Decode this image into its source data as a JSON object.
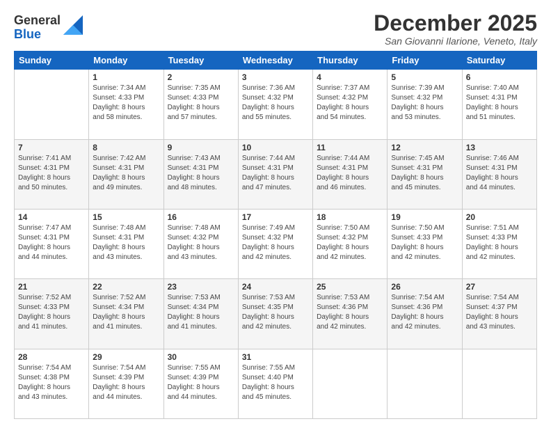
{
  "logo": {
    "general": "General",
    "blue": "Blue"
  },
  "title": "December 2025",
  "location": "San Giovanni Ilarione, Veneto, Italy",
  "days_of_week": [
    "Sunday",
    "Monday",
    "Tuesday",
    "Wednesday",
    "Thursday",
    "Friday",
    "Saturday"
  ],
  "weeks": [
    [
      {
        "day": "",
        "info": ""
      },
      {
        "day": "1",
        "info": "Sunrise: 7:34 AM\nSunset: 4:33 PM\nDaylight: 8 hours\nand 58 minutes."
      },
      {
        "day": "2",
        "info": "Sunrise: 7:35 AM\nSunset: 4:33 PM\nDaylight: 8 hours\nand 57 minutes."
      },
      {
        "day": "3",
        "info": "Sunrise: 7:36 AM\nSunset: 4:32 PM\nDaylight: 8 hours\nand 55 minutes."
      },
      {
        "day": "4",
        "info": "Sunrise: 7:37 AM\nSunset: 4:32 PM\nDaylight: 8 hours\nand 54 minutes."
      },
      {
        "day": "5",
        "info": "Sunrise: 7:39 AM\nSunset: 4:32 PM\nDaylight: 8 hours\nand 53 minutes."
      },
      {
        "day": "6",
        "info": "Sunrise: 7:40 AM\nSunset: 4:31 PM\nDaylight: 8 hours\nand 51 minutes."
      }
    ],
    [
      {
        "day": "7",
        "info": "Sunrise: 7:41 AM\nSunset: 4:31 PM\nDaylight: 8 hours\nand 50 minutes."
      },
      {
        "day": "8",
        "info": "Sunrise: 7:42 AM\nSunset: 4:31 PM\nDaylight: 8 hours\nand 49 minutes."
      },
      {
        "day": "9",
        "info": "Sunrise: 7:43 AM\nSunset: 4:31 PM\nDaylight: 8 hours\nand 48 minutes."
      },
      {
        "day": "10",
        "info": "Sunrise: 7:44 AM\nSunset: 4:31 PM\nDaylight: 8 hours\nand 47 minutes."
      },
      {
        "day": "11",
        "info": "Sunrise: 7:44 AM\nSunset: 4:31 PM\nDaylight: 8 hours\nand 46 minutes."
      },
      {
        "day": "12",
        "info": "Sunrise: 7:45 AM\nSunset: 4:31 PM\nDaylight: 8 hours\nand 45 minutes."
      },
      {
        "day": "13",
        "info": "Sunrise: 7:46 AM\nSunset: 4:31 PM\nDaylight: 8 hours\nand 44 minutes."
      }
    ],
    [
      {
        "day": "14",
        "info": "Sunrise: 7:47 AM\nSunset: 4:31 PM\nDaylight: 8 hours\nand 44 minutes."
      },
      {
        "day": "15",
        "info": "Sunrise: 7:48 AM\nSunset: 4:31 PM\nDaylight: 8 hours\nand 43 minutes."
      },
      {
        "day": "16",
        "info": "Sunrise: 7:48 AM\nSunset: 4:32 PM\nDaylight: 8 hours\nand 43 minutes."
      },
      {
        "day": "17",
        "info": "Sunrise: 7:49 AM\nSunset: 4:32 PM\nDaylight: 8 hours\nand 42 minutes."
      },
      {
        "day": "18",
        "info": "Sunrise: 7:50 AM\nSunset: 4:32 PM\nDaylight: 8 hours\nand 42 minutes."
      },
      {
        "day": "19",
        "info": "Sunrise: 7:50 AM\nSunset: 4:33 PM\nDaylight: 8 hours\nand 42 minutes."
      },
      {
        "day": "20",
        "info": "Sunrise: 7:51 AM\nSunset: 4:33 PM\nDaylight: 8 hours\nand 42 minutes."
      }
    ],
    [
      {
        "day": "21",
        "info": "Sunrise: 7:52 AM\nSunset: 4:33 PM\nDaylight: 8 hours\nand 41 minutes."
      },
      {
        "day": "22",
        "info": "Sunrise: 7:52 AM\nSunset: 4:34 PM\nDaylight: 8 hours\nand 41 minutes."
      },
      {
        "day": "23",
        "info": "Sunrise: 7:53 AM\nSunset: 4:34 PM\nDaylight: 8 hours\nand 41 minutes."
      },
      {
        "day": "24",
        "info": "Sunrise: 7:53 AM\nSunset: 4:35 PM\nDaylight: 8 hours\nand 42 minutes."
      },
      {
        "day": "25",
        "info": "Sunrise: 7:53 AM\nSunset: 4:36 PM\nDaylight: 8 hours\nand 42 minutes."
      },
      {
        "day": "26",
        "info": "Sunrise: 7:54 AM\nSunset: 4:36 PM\nDaylight: 8 hours\nand 42 minutes."
      },
      {
        "day": "27",
        "info": "Sunrise: 7:54 AM\nSunset: 4:37 PM\nDaylight: 8 hours\nand 43 minutes."
      }
    ],
    [
      {
        "day": "28",
        "info": "Sunrise: 7:54 AM\nSunset: 4:38 PM\nDaylight: 8 hours\nand 43 minutes."
      },
      {
        "day": "29",
        "info": "Sunrise: 7:54 AM\nSunset: 4:39 PM\nDaylight: 8 hours\nand 44 minutes."
      },
      {
        "day": "30",
        "info": "Sunrise: 7:55 AM\nSunset: 4:39 PM\nDaylight: 8 hours\nand 44 minutes."
      },
      {
        "day": "31",
        "info": "Sunrise: 7:55 AM\nSunset: 4:40 PM\nDaylight: 8 hours\nand 45 minutes."
      },
      {
        "day": "",
        "info": ""
      },
      {
        "day": "",
        "info": ""
      },
      {
        "day": "",
        "info": ""
      }
    ]
  ]
}
